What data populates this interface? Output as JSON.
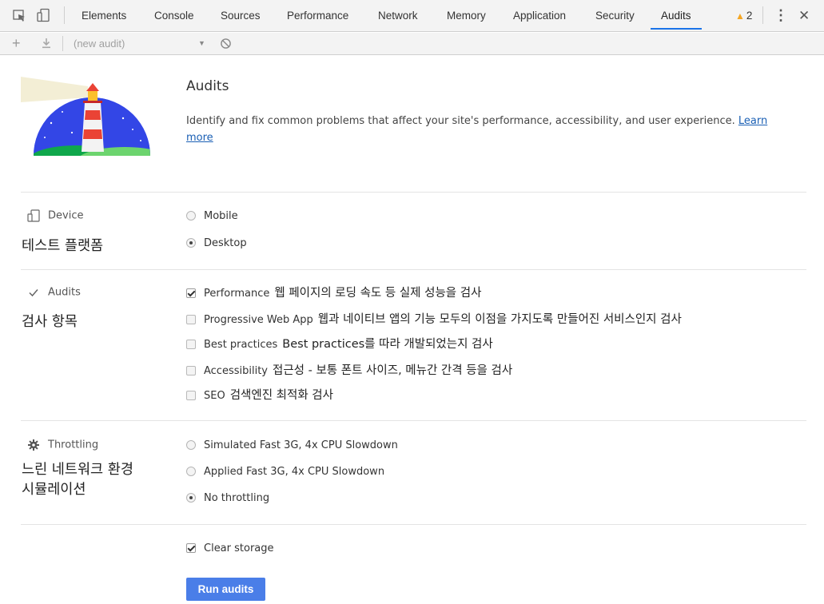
{
  "devtools": {
    "tabs": [
      "Elements",
      "Console",
      "Sources",
      "Performance",
      "Network",
      "Memory",
      "Application",
      "Security",
      "Audits"
    ],
    "active_tab": "Audits",
    "warning_count": "2",
    "accent": "#1a73e8"
  },
  "toolbar": {
    "audit_select": "(new audit)"
  },
  "header": {
    "title": "Audits",
    "description": "Identify and fix common problems that affect your site's performance, accessibility, and user experience. ",
    "learn_more": "Learn more"
  },
  "device": {
    "label": "Device",
    "note": "테스트 플랫폼",
    "options": [
      {
        "label": "Mobile",
        "selected": false
      },
      {
        "label": "Desktop",
        "selected": true
      }
    ]
  },
  "audits": {
    "label": "Audits",
    "note": "검사 항목",
    "items": [
      {
        "label": "Performance",
        "note": "웹 페이지의 로딩 속도 등 실제 성능을 검사",
        "checked": true
      },
      {
        "label": "Progressive Web App",
        "note": "웹과 네이티브 앱의 기능 모두의 이점을 가지도록 만들어진 서비스인지 검사",
        "checked": false
      },
      {
        "label": "Best practices",
        "note": "Best practices를 따라 개발되었는지 검사",
        "checked": false
      },
      {
        "label": "Accessibility",
        "note": "접근성 - 보통 폰트 사이즈, 메뉴간 간격 등을 검사",
        "checked": false
      },
      {
        "label": "SEO",
        "note": "검색엔진 최적화 검사",
        "checked": false
      }
    ]
  },
  "throttling": {
    "label": "Throttling",
    "note_line1": "느린 네트워크 환경",
    "note_line2": "시뮬레이션",
    "options": [
      {
        "label": "Simulated Fast 3G, 4x CPU Slowdown",
        "selected": false
      },
      {
        "label": "Applied Fast 3G, 4x CPU Slowdown",
        "selected": false
      },
      {
        "label": "No throttling",
        "selected": true
      }
    ]
  },
  "clear_storage": {
    "label": "Clear storage",
    "checked": true
  },
  "run_button": {
    "label": "Run audits",
    "color": "#4a7ee8"
  }
}
